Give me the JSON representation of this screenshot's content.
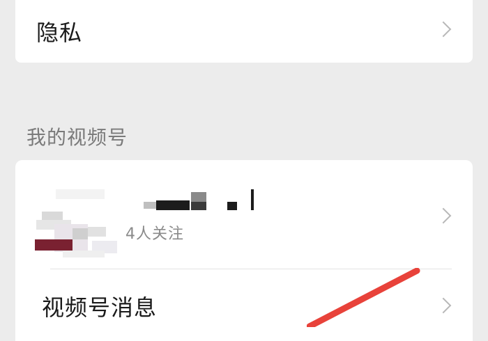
{
  "privacy": {
    "label": "隐私"
  },
  "channels_section": {
    "title": "我的视频号",
    "account": {
      "followers": "4人关注"
    },
    "messages": {
      "label": "视频号消息"
    }
  },
  "icons": [
    "chevron-right-icon"
  ],
  "colors": {
    "background": "#ececec",
    "card": "#ffffff",
    "annotation": "#e8423a"
  }
}
